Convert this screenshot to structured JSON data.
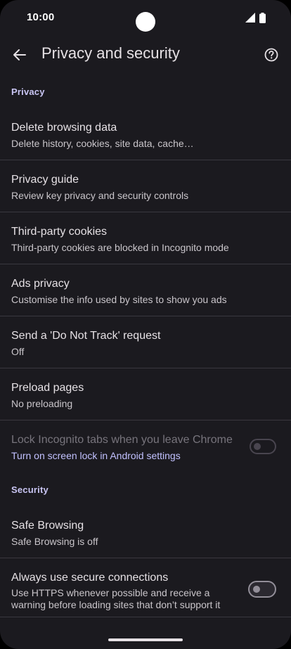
{
  "status_bar": {
    "time": "10:00",
    "icons": [
      "signal-icon",
      "battery-icon"
    ]
  },
  "app_bar": {
    "title": "Privacy and security",
    "back_icon": "arrow-back-icon",
    "help_icon": "help-icon"
  },
  "sections": {
    "privacy": {
      "header": "Privacy",
      "items": [
        {
          "title": "Delete browsing data",
          "subtitle": "Delete history, cookies, site data, cache…"
        },
        {
          "title": "Privacy guide",
          "subtitle": "Review key privacy and security controls"
        },
        {
          "title": "Third-party cookies",
          "subtitle": "Third-party cookies are blocked in Incognito mode"
        },
        {
          "title": "Ads privacy",
          "subtitle": "Customise the info used by sites to show you ads"
        },
        {
          "title": "Send a 'Do Not Track' request",
          "subtitle": "Off"
        },
        {
          "title": "Preload pages",
          "subtitle": "No preloading"
        },
        {
          "title": "Lock Incognito tabs when you leave Chrome",
          "subtitle": "Turn on screen lock in Android settings",
          "toggle_on": false,
          "disabled": true
        }
      ]
    },
    "security": {
      "header": "Security",
      "items": [
        {
          "title": "Safe Browsing",
          "subtitle": "Safe Browsing is off"
        },
        {
          "title": "Always use secure connections",
          "subtitle": "Use HTTPS whenever possible and receive a warning before loading sites that don’t support it",
          "toggle_on": false
        }
      ]
    }
  },
  "colors": {
    "background": "#1b1a1f",
    "section_header": "#c9c5f3",
    "link": "#c2c1ff",
    "divider": "#3a383f",
    "disabled_text": "#77747c"
  }
}
